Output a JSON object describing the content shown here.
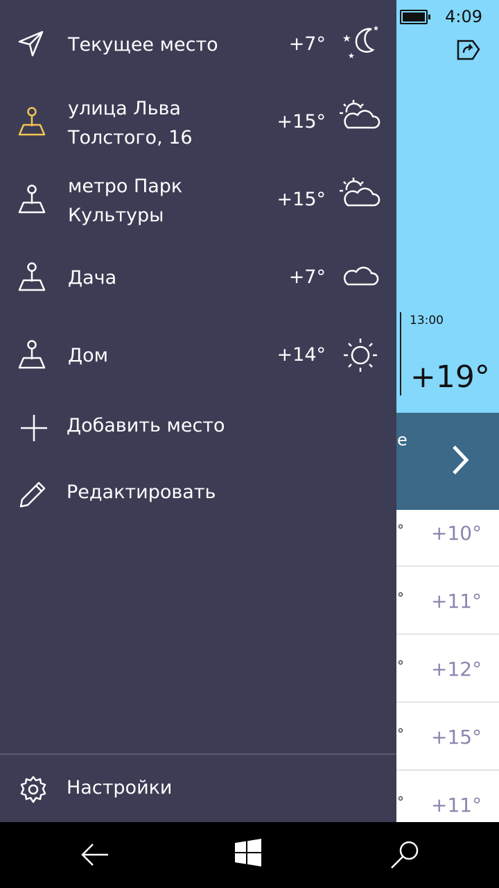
{
  "status": {
    "time": "4:09"
  },
  "background": {
    "hour": "13:00",
    "hour_temp": "+19°",
    "band_text": "е",
    "rows": [
      {
        "deg": "°",
        "temp": "+10°"
      },
      {
        "deg": "°",
        "temp": "+11°"
      },
      {
        "deg": "°",
        "temp": "+12°"
      },
      {
        "deg": "°",
        "temp": "+15°"
      },
      {
        "deg": "°",
        "temp": "+11°"
      }
    ]
  },
  "drawer": {
    "locations": [
      {
        "name": "Текущее место",
        "temp": "+7°",
        "weather_icon": "night-moon-icon",
        "icon": "location-arrow-icon",
        "active": false
      },
      {
        "name": "улица Льва Толстого, 16",
        "temp": "+15°",
        "weather_icon": "partly-cloudy-icon",
        "icon": "map-pin-icon",
        "active": true
      },
      {
        "name": "метро Парк Культуры",
        "temp": "+15°",
        "weather_icon": "partly-cloudy-icon",
        "icon": "map-pin-icon",
        "active": false
      },
      {
        "name": "Дача",
        "temp": "+7°",
        "weather_icon": "cloud-icon",
        "icon": "map-pin-icon",
        "active": false
      },
      {
        "name": "Дом",
        "temp": "+14°",
        "weather_icon": "sun-icon",
        "icon": "map-pin-icon",
        "active": false
      }
    ],
    "add_label": "Добавить место",
    "edit_label": "Редактировать",
    "settings_label": "Настройки"
  },
  "colors": {
    "drawer_bg": "#3c3c54",
    "accent": "#f3c552",
    "sky": "#84d8fb"
  }
}
